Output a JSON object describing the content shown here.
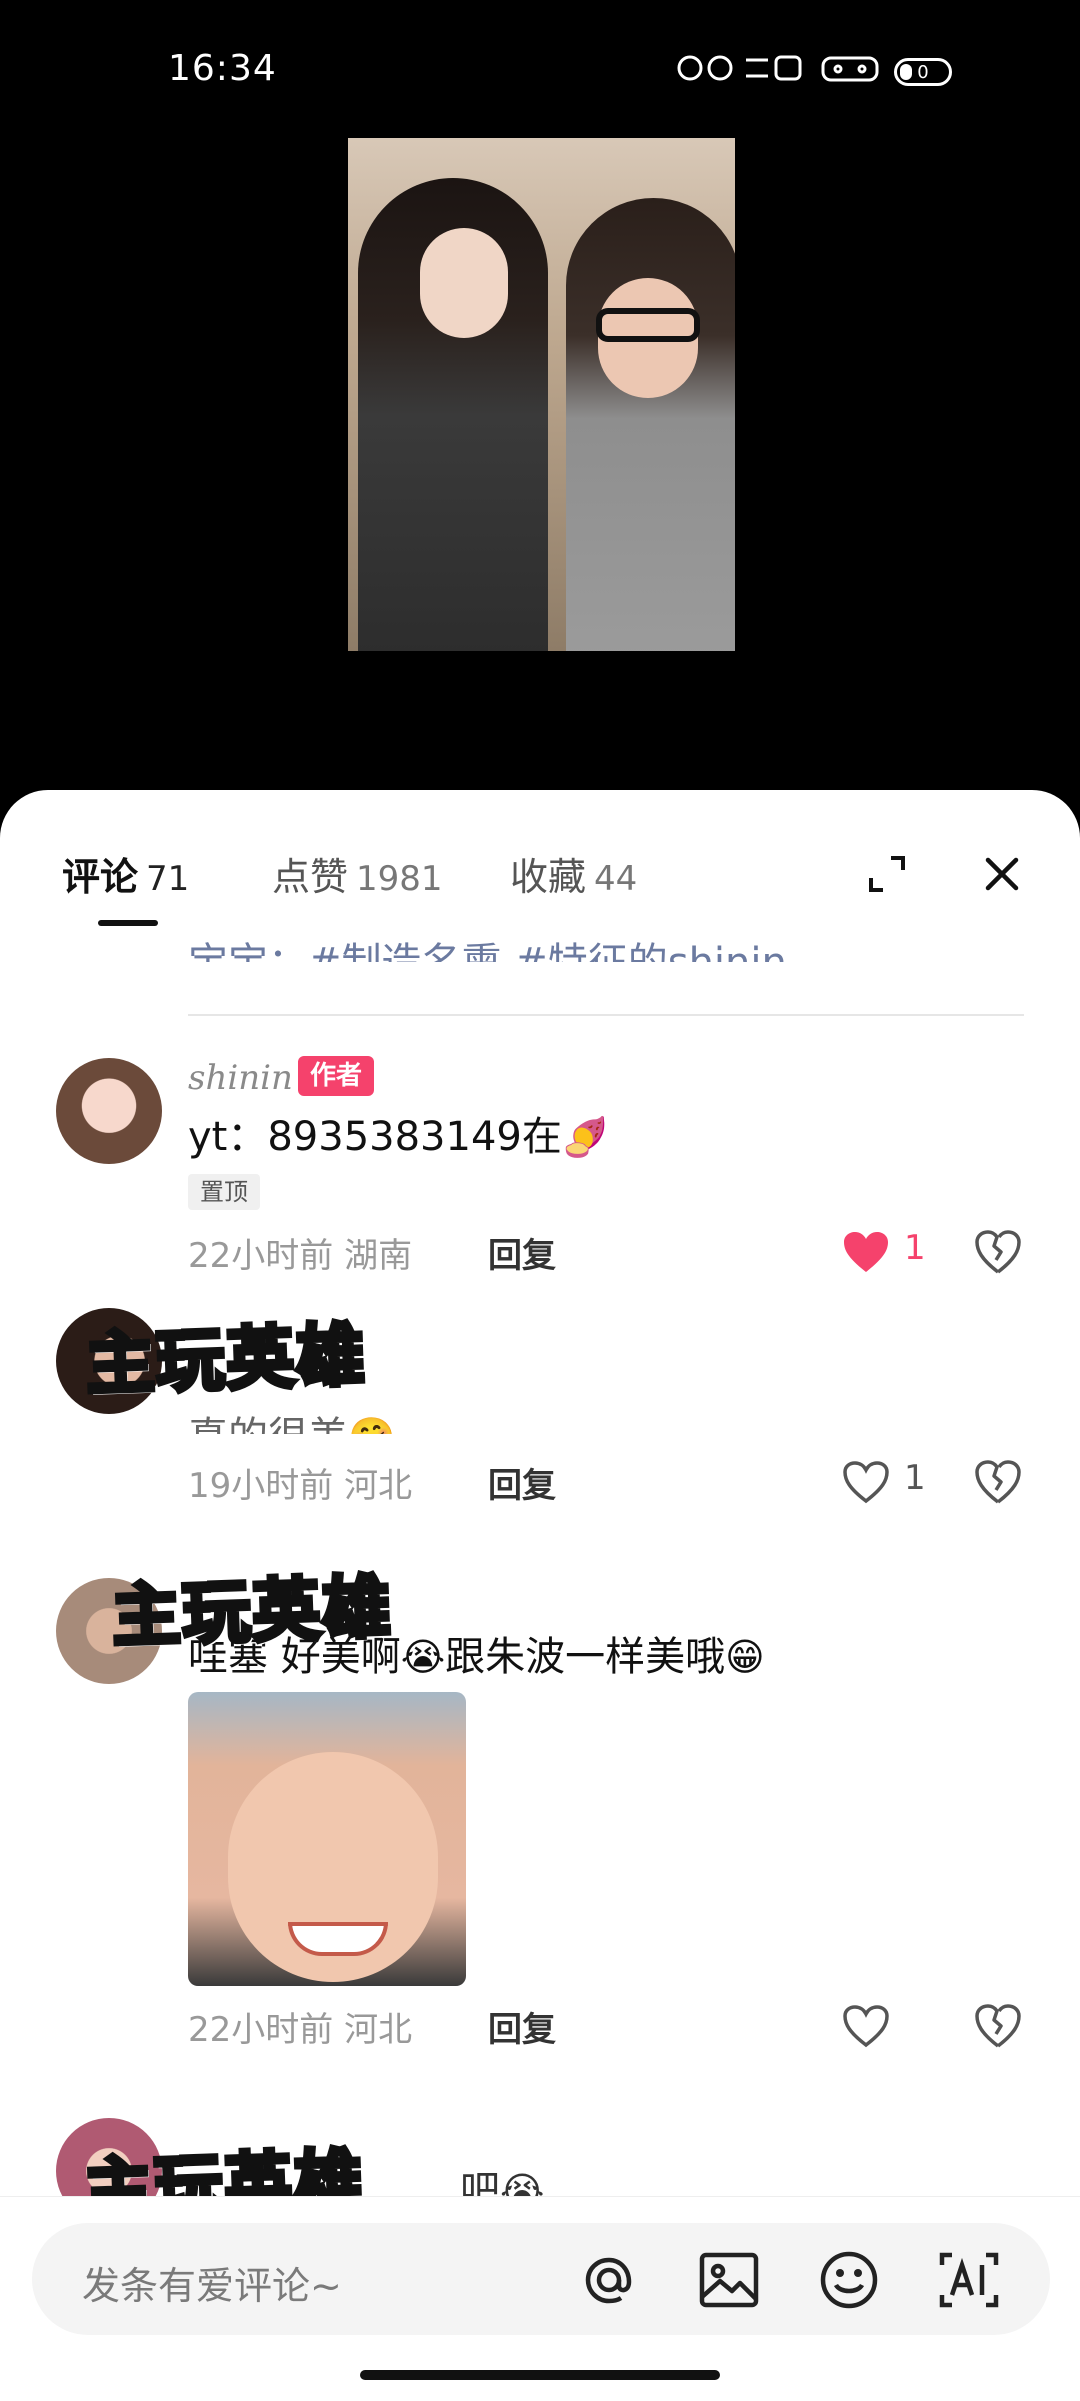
{
  "status_bar": {
    "time": "16:34",
    "battery": "0"
  },
  "tabs": [
    {
      "label": "评论",
      "count": "71",
      "active": true
    },
    {
      "label": "点赞",
      "count": "1981",
      "active": false
    },
    {
      "label": "收藏",
      "count": "44",
      "active": false
    }
  ],
  "previous_comment_text": "宝宝：#制造名熏 #特征的shinin",
  "comments": [
    {
      "username": "shinin",
      "author_badge": "作者",
      "text": "yt：8935383149在",
      "text_emoji": "🍠",
      "pin_badge": "置顶",
      "time_location": "22小时前 湖南",
      "reply_label": "回复",
      "like_count": "1",
      "liked": true
    },
    {
      "sticker": "主玩英雄",
      "text": "真的很美",
      "text_emoji": "🤗",
      "time_location": "19小时前 河北",
      "reply_label": "回复",
      "like_count": "1",
      "liked": false
    },
    {
      "sticker": "主玩英雄",
      "text_a": "哇塞 好美啊",
      "emoji_a": "😭",
      "text_b": "跟朱波一样美哦",
      "emoji_b": "😁",
      "time_location": "22小时前 河北",
      "reply_label": "回复",
      "like_count": "",
      "liked": false
    },
    {
      "sticker": "主玩英雄",
      "text": "吧",
      "text_emoji": "😭"
    }
  ],
  "input": {
    "placeholder": "发条有爱评论~"
  },
  "colors": {
    "accent": "#f5426c",
    "like": "#f5426c"
  }
}
